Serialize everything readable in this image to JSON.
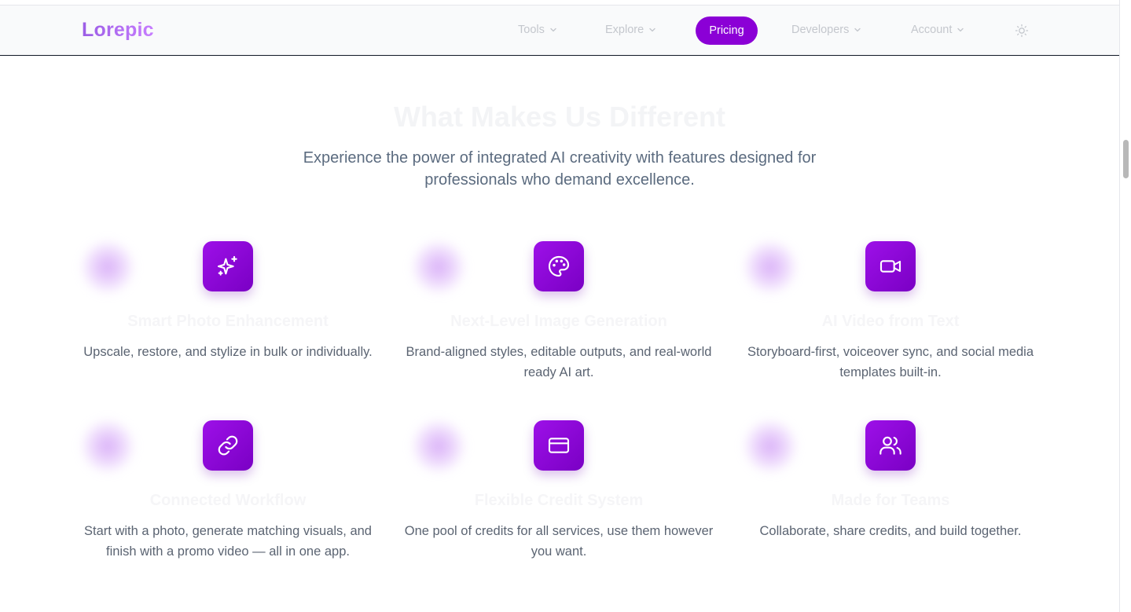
{
  "nav": {
    "logo": "Lorepic",
    "items": [
      {
        "label": "Tools"
      },
      {
        "label": "Explore"
      },
      {
        "label": "Pricing"
      },
      {
        "label": "Developers"
      },
      {
        "label": "Account"
      }
    ],
    "theme_icon": "sun-icon"
  },
  "section": {
    "title": "What Makes Us Different",
    "subtitle": "Experience the power of integrated AI creativity with features designed for professionals who demand excellence."
  },
  "features": [
    {
      "icon": "sparkles-icon",
      "title": "Smart Photo Enhancement",
      "desc": "Upscale, restore, and stylize in bulk or individually."
    },
    {
      "icon": "palette-icon",
      "title": "Next-Level Image Generation",
      "desc": "Brand-aligned styles, editable outputs, and real-world ready AI art."
    },
    {
      "icon": "video-camera-icon",
      "title": "AI Video from Text",
      "desc": "Storyboard-first, voiceover sync, and social media templates built-in."
    },
    {
      "icon": "link-icon",
      "title": "Connected Workflow",
      "desc": "Start with a photo, generate matching visuals, and finish with a promo video — all in one app."
    },
    {
      "icon": "credit-card-icon",
      "title": "Flexible Credit System",
      "desc": "One pool of credits for all services, use them however you want."
    },
    {
      "icon": "users-icon",
      "title": "Made for Teams",
      "desc": "Collaborate, share credits, and build together."
    }
  ],
  "colors": {
    "accent": "#8b00d6",
    "logo_gradient_start": "#9b5de5",
    "logo_gradient_end": "#c77dff"
  }
}
